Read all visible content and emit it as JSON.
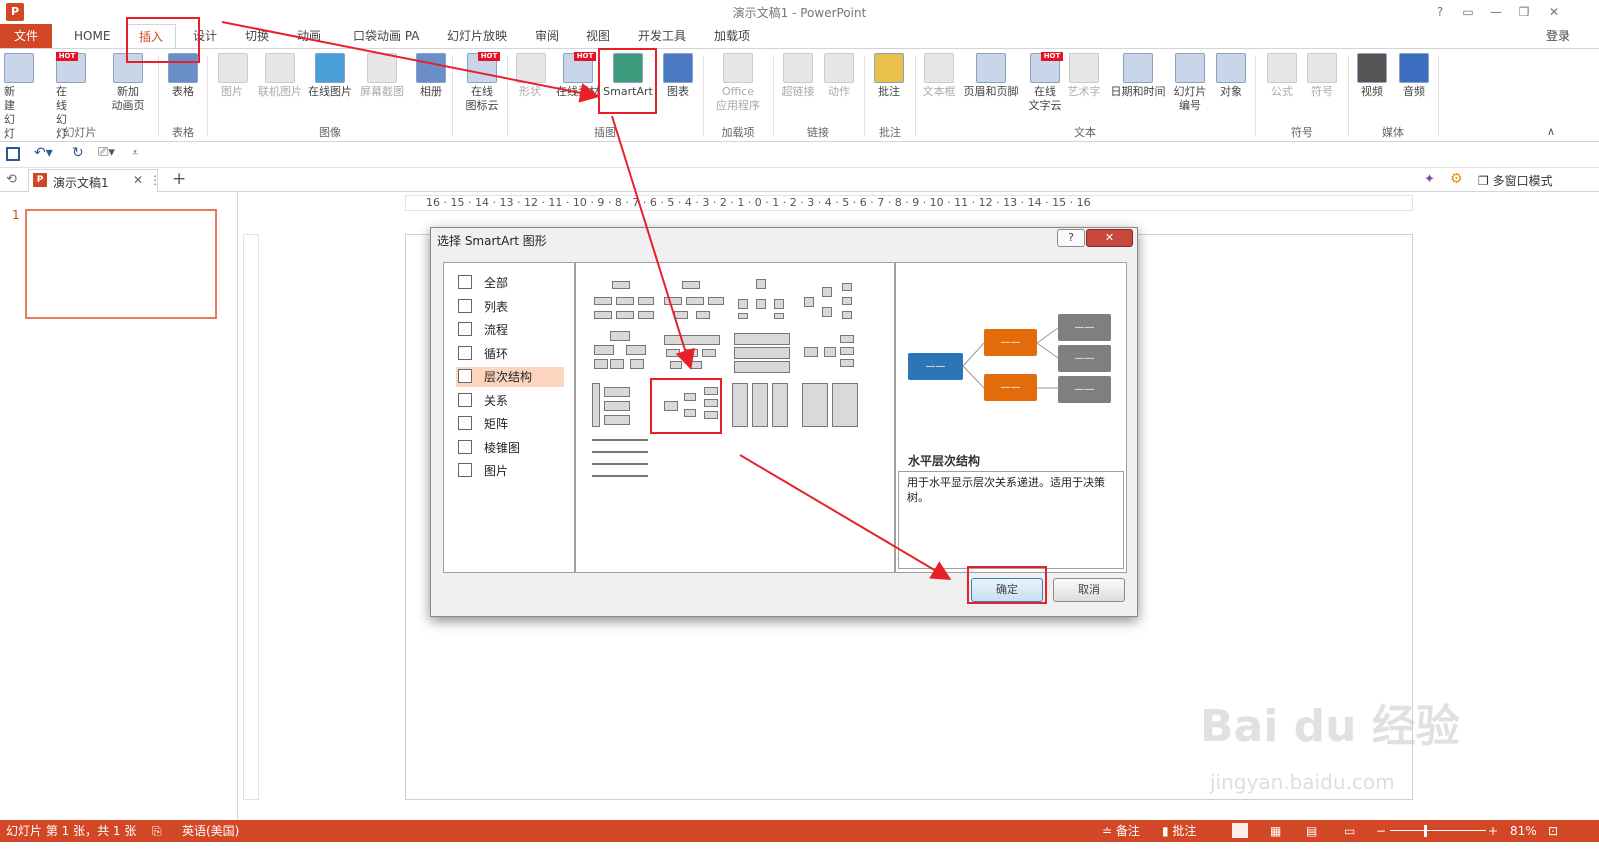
{
  "window": {
    "title": "演示文稿1 - PowerPoint",
    "logo": "P",
    "help": "?",
    "signin": "登录"
  },
  "tabs": [
    "文件",
    "HOME",
    "插入",
    "设计",
    "切换",
    "动画",
    "口袋动画 PA",
    "幻灯片放映",
    "审阅",
    "视图",
    "开发工具",
    "加载项"
  ],
  "active_tab": "插入",
  "ribbon": {
    "buttons": [
      {
        "label": "新建\n幻灯片",
        "name": "new-slide",
        "icon": "new-slide-icon"
      },
      {
        "label": "在线\n幻灯片",
        "name": "online-slide",
        "icon": "online-slide-icon",
        "hot": true
      },
      {
        "label": "新加\n动画页",
        "name": "new-anim-page",
        "icon": "anim-page-icon"
      },
      {
        "label": "表格",
        "name": "table",
        "icon": "table-icon"
      },
      {
        "label": "图片",
        "name": "picture",
        "icon": "picture-icon",
        "dim": true
      },
      {
        "label": "联机图片",
        "name": "online-picture",
        "icon": "online-picture-icon",
        "dim": true
      },
      {
        "label": "在线图片",
        "name": "web-picture",
        "icon": "web-picture-icon"
      },
      {
        "label": "屏幕截图",
        "name": "screenshot",
        "icon": "camera-icon",
        "dim": true
      },
      {
        "label": "相册",
        "name": "album",
        "icon": "album-icon"
      },
      {
        "label": "在线\n图标云",
        "name": "icon-cloud",
        "icon": "icon-cloud-icon",
        "hot": true
      },
      {
        "label": "形状",
        "name": "shapes",
        "icon": "shapes-icon",
        "dim": true
      },
      {
        "label": "在线素材",
        "name": "online-material",
        "icon": "material-icon",
        "hot": true
      },
      {
        "label": "SmartArt",
        "name": "smartart",
        "icon": "smartart-icon"
      },
      {
        "label": "图表",
        "name": "chart",
        "icon": "chart-icon"
      },
      {
        "label": "Office\n应用程序",
        "name": "office-apps",
        "icon": "office-apps-icon",
        "dim": true
      },
      {
        "label": "超链接",
        "name": "hyperlink",
        "icon": "globe-icon",
        "dim": true
      },
      {
        "label": "动作",
        "name": "action",
        "icon": "star-icon",
        "dim": true
      },
      {
        "label": "批注",
        "name": "comment",
        "icon": "comment-icon"
      },
      {
        "label": "文本框",
        "name": "textbox",
        "icon": "textbox-icon",
        "dim": true
      },
      {
        "label": "页眉和页脚",
        "name": "header-footer",
        "icon": "header-footer-icon"
      },
      {
        "label": "在线\n文字云",
        "name": "word-cloud",
        "icon": "word-cloud-icon",
        "hot": true
      },
      {
        "label": "艺术字",
        "name": "wordart",
        "icon": "wordart-icon",
        "dim": true
      },
      {
        "label": "日期和时间",
        "name": "datetime",
        "icon": "calendar-icon"
      },
      {
        "label": "幻灯片\n编号",
        "name": "slide-number",
        "icon": "hash-icon"
      },
      {
        "label": "对象",
        "name": "object",
        "icon": "object-icon"
      },
      {
        "label": "公式",
        "name": "equation",
        "icon": "pi-icon",
        "dim": true
      },
      {
        "label": "符号",
        "name": "symbol",
        "icon": "omega-icon",
        "dim": true
      },
      {
        "label": "视频",
        "name": "video",
        "icon": "film-icon"
      },
      {
        "label": "音频",
        "name": "audio",
        "icon": "speaker-icon"
      }
    ],
    "groups": [
      "幻灯片",
      "表格",
      "图像",
      "插图",
      "加载项",
      "链接",
      "批注",
      "文本",
      "符号",
      "媒体"
    ]
  },
  "doc_tab": {
    "name": "演示文稿1",
    "more": "⋮",
    "add": "+",
    "multiwindow": "多窗口模式"
  },
  "slide_number": "1",
  "ruler_h": "16 · 15 · 14 · 13 · 12 · 11 · 10 · 9 · 8 · 7 · 6 · 5 · 4 · 3 · 2 · 1 · 0 · 1 · 2 · 3 · 4 · 5 · 6 · 7 · 8 · 9 · 10 · 11 · 12 · 13 · 14 · 15 · 16",
  "dialog": {
    "title": "选择 SmartArt 图形",
    "help": "?",
    "categories": [
      "全部",
      "列表",
      "流程",
      "循环",
      "层次结构",
      "关系",
      "矩阵",
      "棱锥图",
      "图片"
    ],
    "selected_category": "层次结构",
    "preview_title": "水平层次结构",
    "preview_desc": "用于水平显示层次关系递进。适用于决策树。",
    "ok": "确定",
    "cancel": "取消",
    "preview_box_label": "——"
  },
  "status": {
    "slide_info": "幻灯片 第 1 张，共 1 张",
    "language": "英语(美国)",
    "notes": "备注",
    "comments": "批注",
    "zoom": "81%"
  },
  "watermark": {
    "logo": "Bai du 经验",
    "url": "jingyan.baidu.com"
  },
  "colors": {
    "accent": "#d24726",
    "annotation": "#e8202a",
    "preview_blue": "#2e75b6",
    "preview_orange": "#e36c0a",
    "preview_gray": "#7f7f7f"
  }
}
